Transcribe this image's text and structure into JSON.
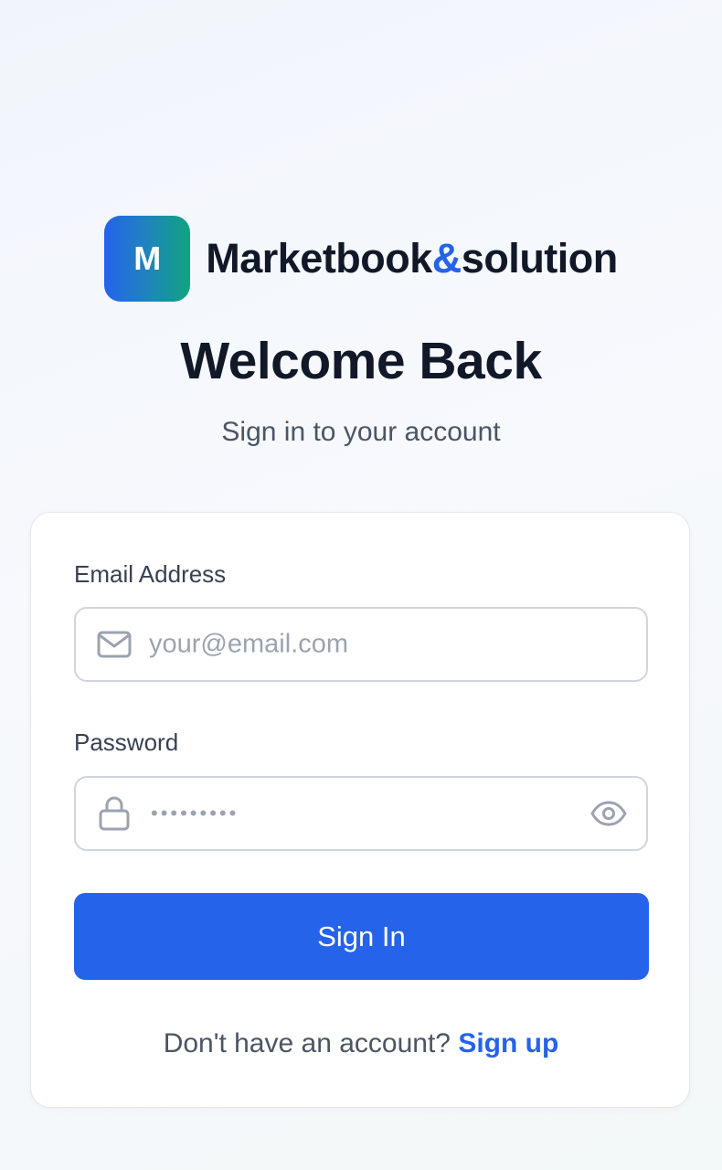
{
  "brand": {
    "logo_letter": "M",
    "name_part1": "Marketbook",
    "name_amp": "&",
    "name_part2": "solution"
  },
  "header": {
    "title": "Welcome Back",
    "subtitle": "Sign in to your account"
  },
  "form": {
    "email": {
      "label": "Email Address",
      "placeholder": "your@email.com",
      "icon": "mail-icon"
    },
    "password": {
      "label": "Password",
      "masked_value": "•••••••••",
      "icon": "lock-icon",
      "toggle_icon": "eye-icon"
    },
    "submit_label": "Sign In"
  },
  "footer": {
    "prompt": "Don't have an account?",
    "link_label": "Sign up"
  },
  "colors": {
    "accent": "#2563eb",
    "logo_gradient_start": "#2563eb",
    "logo_gradient_end": "#10a37f",
    "heading": "#111827",
    "muted_text": "#4b5563",
    "placeholder": "#9ca3af"
  }
}
